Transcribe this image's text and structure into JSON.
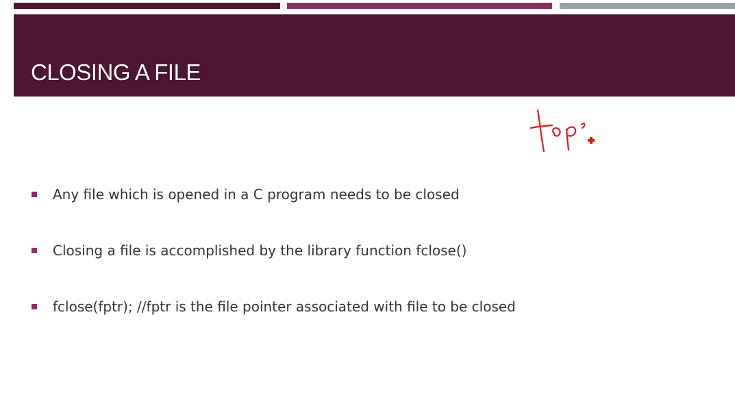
{
  "slide": {
    "title": "CLOSING A FILE",
    "bullets": [
      {
        "text": "Any file which is opened in a C program needs to be closed"
      },
      {
        "text": "Closing a file is accomplished by the library function fclose()"
      },
      {
        "text": "fclose(fptr);  //fptr is the file pointer associated with file to be closed"
      }
    ],
    "annotation": {
      "text": "top",
      "color": "#e0191b"
    }
  },
  "colors": {
    "title_band": "#4e1634",
    "stripe_left": "#4e1634",
    "stripe_middle": "#8a2d63",
    "stripe_right": "#9aa2a8",
    "bullet": "#8a2d63",
    "body_text": "#333333"
  }
}
